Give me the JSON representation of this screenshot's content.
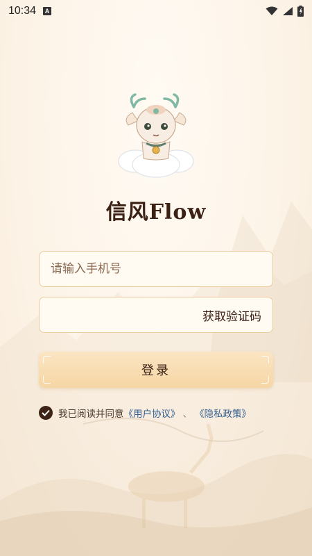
{
  "status_bar": {
    "time": "10:34",
    "notification_icon": "a-icon"
  },
  "app": {
    "title": "信风Flow"
  },
  "form": {
    "phone_placeholder": "请输入手机号",
    "code_placeholder": "",
    "get_code_label": "获取验证码",
    "login_label": "登录"
  },
  "agreement": {
    "checked": true,
    "prefix": "我已阅读并同意",
    "user_agreement": "《用户协议》",
    "separator": "、",
    "privacy_policy": "《隐私政策》"
  },
  "colors": {
    "accent": "#3c2316",
    "field_border": "#eccc9f",
    "button": "#f6d6a4",
    "link": "#2f5d8f"
  }
}
